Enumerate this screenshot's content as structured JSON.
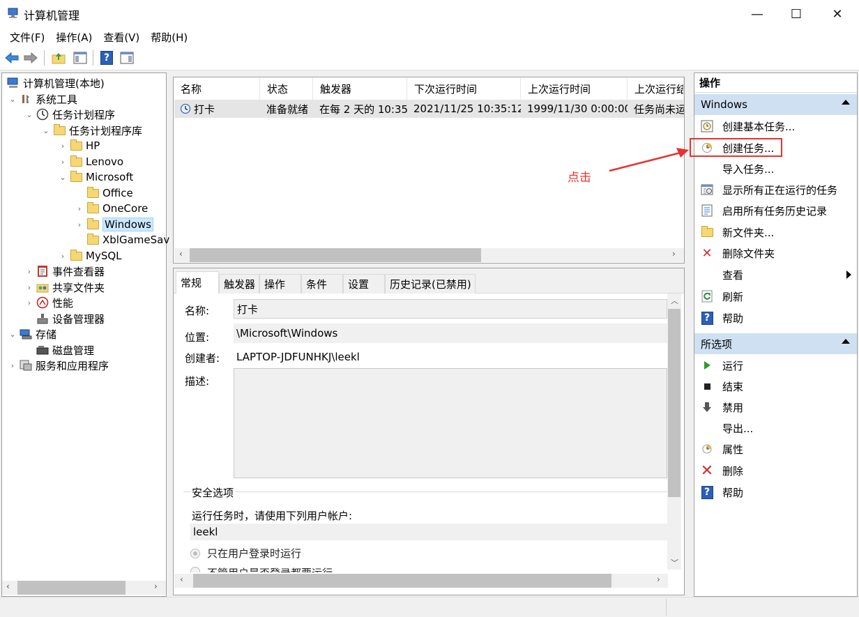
{
  "window": {
    "title": "计算机管理",
    "minimize": "—",
    "maximize": "☐",
    "close": "✕"
  },
  "menu": [
    {
      "label": "文件(F)"
    },
    {
      "label": "操作(A)"
    },
    {
      "label": "查看(V)"
    },
    {
      "label": "帮助(H)"
    }
  ],
  "tree": {
    "root": "计算机管理(本地)",
    "system_tools": "系统工具",
    "task_scheduler": "任务计划程序",
    "task_library": "任务计划程序库",
    "hp": "HP",
    "lenovo": "Lenovo",
    "microsoft": "Microsoft",
    "office": "Office",
    "onecore": "OneCore",
    "windows": "Windows",
    "xbl": "XblGameSav",
    "mysql": "MySQL",
    "event_viewer": "事件查看器",
    "shared_folders": "共享文件夹",
    "performance": "性能",
    "device_manager": "设备管理器",
    "storage": "存储",
    "disk_management": "磁盘管理",
    "services_apps": "服务和应用程序"
  },
  "task_list": {
    "columns": [
      "名称",
      "状态",
      "触发器",
      "下次运行时间",
      "上次运行时间",
      "上次运行结"
    ],
    "rows": [
      {
        "name": "打卡",
        "status": "准备就绪",
        "trigger": "在每 2 天的 10:35",
        "next_run": "2021/11/25 10:35:12",
        "last_run": "1999/11/30 0:00:00",
        "last_result": "任务尚未运"
      }
    ]
  },
  "detail": {
    "tabs": [
      "常规",
      "触发器",
      "操作",
      "条件",
      "设置",
      "历史记录(已禁用)"
    ],
    "name_label": "名称:",
    "name_value": "打卡",
    "location_label": "位置:",
    "location_value": "\\Microsoft\\Windows",
    "author_label": "创建者:",
    "author_value": "LAPTOP-JDFUNHKJ\\leekl",
    "description_label": "描述:",
    "security_title": "安全选项",
    "run_as_label": "运行任务时，请使用下列用户帐户:",
    "run_as_value": "leekl",
    "option_logged_on": "只在用户登录时运行",
    "option_logged_either": "不管用户是否登录都要运行"
  },
  "actions": {
    "header": "操作",
    "section_windows": "Windows",
    "windows_items": [
      {
        "label": "创建基本任务..."
      },
      {
        "label": "创建任务..."
      },
      {
        "label": "导入任务..."
      },
      {
        "label": "显示所有正在运行的任务"
      },
      {
        "label": "启用所有任务历史记录"
      },
      {
        "label": "新文件夹..."
      },
      {
        "label": "删除文件夹"
      },
      {
        "label": "查看"
      },
      {
        "label": "刷新"
      },
      {
        "label": "帮助"
      }
    ],
    "section_selected": "所选项",
    "selected_items": [
      {
        "label": "运行"
      },
      {
        "label": "结束"
      },
      {
        "label": "禁用"
      },
      {
        "label": "导出..."
      },
      {
        "label": "属性"
      },
      {
        "label": "删除"
      },
      {
        "label": "帮助"
      }
    ]
  },
  "annotation": {
    "text": "点击",
    "color": "#e8322d"
  },
  "colors": {
    "selection": "#cce8ff",
    "section_header": "#cfe0f2",
    "highlight": "#e8322d"
  }
}
